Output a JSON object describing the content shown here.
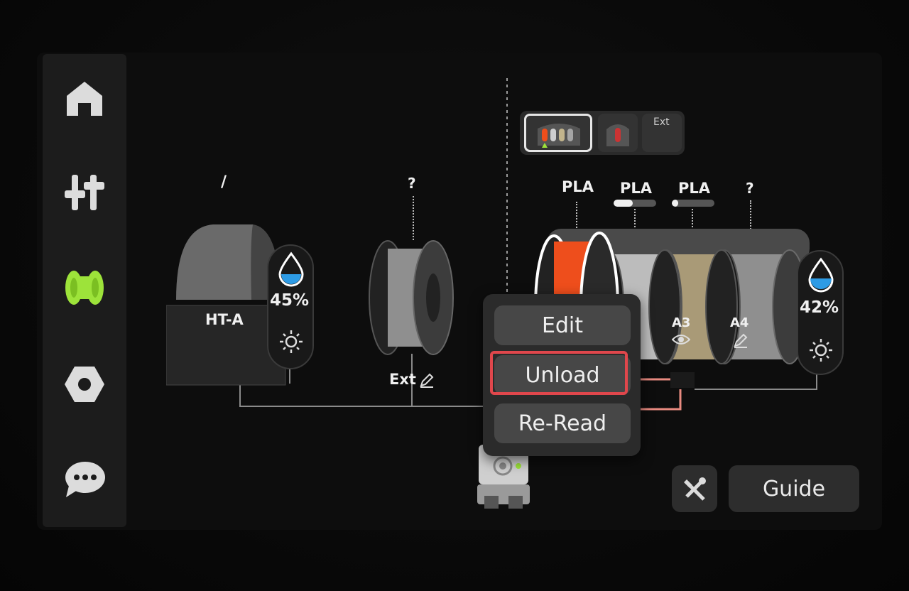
{
  "sidebar": {
    "items": [
      {
        "name": "home-icon"
      },
      {
        "name": "controls-icon"
      },
      {
        "name": "filament-icon",
        "active": true
      },
      {
        "name": "settings-icon"
      },
      {
        "name": "chat-icon"
      }
    ]
  },
  "colors": {
    "accent": "#9de33a",
    "highlight": "#e0474c",
    "humidity": "#2d9be5",
    "orange": "#ee4e1c"
  },
  "left_unit": {
    "top_label": "/",
    "name": "HT-A",
    "humidity": "45%",
    "icons": [
      "humidity-drop-icon",
      "sun-icon"
    ]
  },
  "external_spool": {
    "top_label": "?",
    "name": "Ext",
    "edit_icon": "pencil-icon"
  },
  "ams_tabs": [
    {
      "name": "ams-4slot-tab",
      "selected": true
    },
    {
      "name": "ams-single-tab",
      "selected": false
    },
    {
      "name": "ext-tab",
      "label": "Ext",
      "selected": false
    }
  ],
  "ams_unit": {
    "humidity": "42%",
    "slots": [
      {
        "type": "PLA",
        "label": "",
        "color": "#ee4e1c",
        "remaining": null
      },
      {
        "type": "PLA",
        "label": "",
        "color": "#bcbcbc",
        "remaining": 0.45
      },
      {
        "type": "PLA",
        "label": "A3",
        "color": "#a99a77",
        "remaining": 0.15,
        "icon": "eye-icon"
      },
      {
        "type": "?",
        "label": "A4",
        "color": "#8f8f8f",
        "remaining": null,
        "icon": "pencil-icon"
      }
    ]
  },
  "context_menu": {
    "items": [
      {
        "label": "Edit"
      },
      {
        "label": "Unload",
        "highlighted": true
      },
      {
        "label": "Re-Read"
      }
    ]
  },
  "guide_label": "Guide"
}
